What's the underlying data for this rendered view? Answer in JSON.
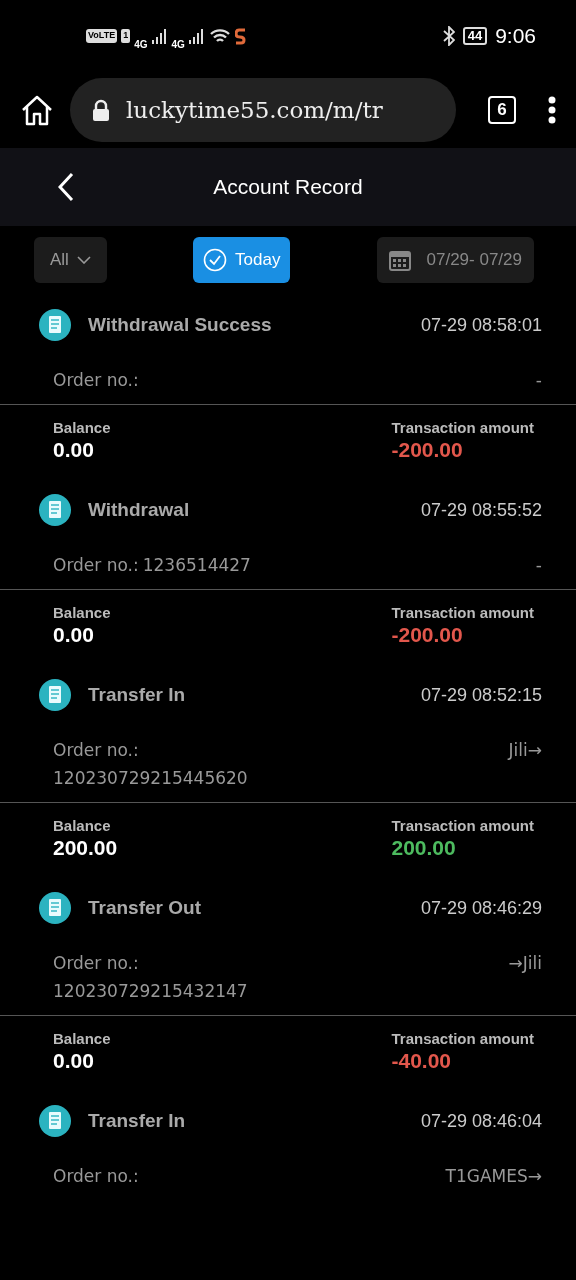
{
  "status_bar": {
    "volte": "VoLTE",
    "sim": "1",
    "network_1": "4G",
    "network_2": "4G",
    "battery": "44",
    "time": "9:06"
  },
  "browser": {
    "url": "luckytime55.com/m/tr",
    "tab_count": "6"
  },
  "header": {
    "title": "Account Record"
  },
  "filters": {
    "type": "All",
    "quick": {
      "label": "Today",
      "selected": true
    },
    "date_range": "07/29- 07/29"
  },
  "records": [
    {
      "title": "Withdrawal Success",
      "time": "07-29 08:58:01",
      "order_label": "Order no.:",
      "reference": "-",
      "balance_label": "Balance",
      "balance": "0.00",
      "amount_label": "Transaction amount",
      "amount": "-200.00",
      "kind": "debit"
    },
    {
      "title": "Withdrawal",
      "time": "07-29 08:55:52",
      "order_label": "Order no.:",
      "order_no": "1236514427",
      "reference": "-",
      "balance_label": "Balance",
      "balance": "0.00",
      "amount_label": "Transaction amount",
      "amount": "-200.00",
      "kind": "debit"
    },
    {
      "title": "Transfer In",
      "time": "07-29 08:52:15",
      "order_label": "Order no.:",
      "order_no": "120230729215445620",
      "reference": "Jili→",
      "balance_label": "Balance",
      "balance": "200.00",
      "amount_label": "Transaction amount",
      "amount": "200.00",
      "kind": "credit"
    },
    {
      "title": "Transfer Out",
      "time": "07-29 08:46:29",
      "order_label": "Order no.:",
      "order_no": "120230729215432147",
      "reference": "→Jili",
      "balance_label": "Balance",
      "balance": "0.00",
      "amount_label": "Transaction amount",
      "amount": "-40.00",
      "kind": "debit"
    },
    {
      "title": "Transfer In",
      "time": "07-29 08:46:04",
      "order_label": "Order no.:",
      "reference": "T1GAMES→"
    }
  ]
}
